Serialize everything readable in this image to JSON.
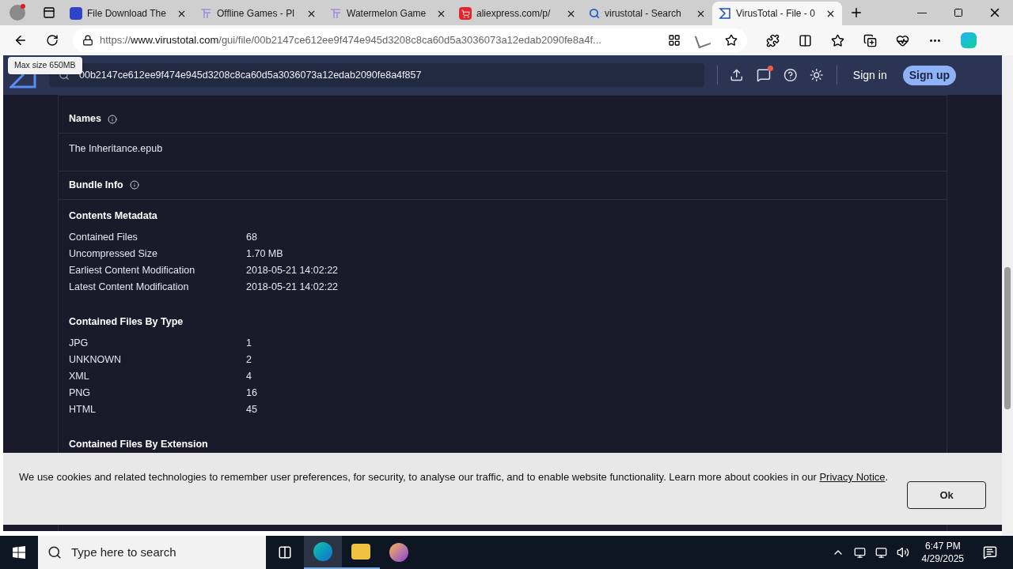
{
  "browser": {
    "tabs": [
      {
        "title": "File Download The",
        "kind": "app",
        "selected": false
      },
      {
        "title": "Offline Games - Pl",
        "kind": "games",
        "selected": false
      },
      {
        "title": "Watermelon Game",
        "kind": "games",
        "selected": false
      },
      {
        "title": "aliexpress.com/p/",
        "kind": "cart",
        "selected": false
      },
      {
        "title": "virustotal - Search",
        "kind": "search",
        "selected": false
      },
      {
        "title": "VirusTotal - File - 0",
        "kind": "sigma",
        "selected": true
      }
    ],
    "url_scheme": "https://",
    "url_host": "www.virustotal.com",
    "url_path": "/gui/file/00b2147ce612ee9f474e945d3208c8ca60d5a3036073a12edab2090fe8a4f..."
  },
  "header": {
    "search_value": "00b2147ce612ee9f474e945d3208c8ca60d5a3036073a12edab2090fe8a4f857",
    "tooltip": "Max size 650MB",
    "sign_in": "Sign in",
    "sign_up": "Sign up"
  },
  "names": {
    "title": "Names",
    "items": [
      "The Inheritance.epub"
    ]
  },
  "bundle_info": {
    "title": "Bundle Info",
    "groups": [
      {
        "title": "Contents Metadata",
        "rows": [
          [
            "Contained Files",
            "68"
          ],
          [
            "Uncompressed Size",
            "1.70 MB"
          ],
          [
            "Earliest Content Modification",
            "2018-05-21 14:02:22"
          ],
          [
            "Latest Content Modification",
            "2018-05-21 14:02:22"
          ]
        ]
      },
      {
        "title": "Contained Files By Type",
        "rows": [
          [
            "JPG",
            "1"
          ],
          [
            "UNKNOWN",
            "2"
          ],
          [
            "XML",
            "4"
          ],
          [
            "PNG",
            "16"
          ],
          [
            "HTML",
            "45"
          ]
        ]
      },
      {
        "title": "Contained Files By Extension"
      }
    ]
  },
  "cookie_banner": {
    "text": "We use cookies and related technologies to remember user preferences, for security, to analyse our traffic, and to enable website functionality. Learn more about cookies in our",
    "link": "Privacy Notice",
    "end": ".",
    "button": "Ok"
  },
  "taskbar": {
    "search_placeholder": "Type here to search",
    "time": "6:47 PM",
    "date": "4/29/2025"
  }
}
